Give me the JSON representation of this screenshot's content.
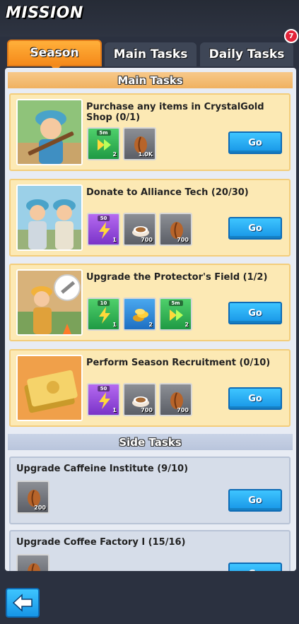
{
  "header": {
    "title": "MISSION"
  },
  "tabs": [
    {
      "label": "Season",
      "active": true
    },
    {
      "label": "Main Tasks",
      "active": false
    },
    {
      "label": "Daily Tasks",
      "active": false
    }
  ],
  "badge": {
    "count": "7"
  },
  "sections": {
    "main_title": "Main Tasks",
    "side_title": "Side Tasks"
  },
  "main_tasks": [
    {
      "title": "Purchase any items in CrystalGold Shop (0/1)",
      "thumb_icon": "soldier-with-rifle-icon",
      "rewards": [
        {
          "icon": "speedup-icon",
          "color": "green",
          "tag": "5m",
          "qty": "2"
        },
        {
          "icon": "coffee-bean-icon",
          "color": "gray",
          "tag": "",
          "qty": "1.0K"
        }
      ],
      "go_label": "Go"
    },
    {
      "title": "Donate to Alliance Tech (20/30)",
      "thumb_icon": "two-soldiers-icon",
      "rewards": [
        {
          "icon": "lightning-icon",
          "color": "purple",
          "tag": "50",
          "qty": "1"
        },
        {
          "icon": "coffee-cup-icon",
          "color": "gray",
          "tag": "",
          "qty": "700"
        },
        {
          "icon": "coffee-bean-icon",
          "color": "gray",
          "tag": "",
          "qty": "700"
        }
      ],
      "go_label": "Go"
    },
    {
      "title": "Upgrade the Protector's Field (1/2)",
      "thumb_icon": "builder-hammer-icon",
      "rewards": [
        {
          "icon": "lightning-icon",
          "color": "green",
          "tag": "10",
          "qty": "1"
        },
        {
          "icon": "gold-coins-icon",
          "color": "blue",
          "tag": "",
          "qty": "2"
        },
        {
          "icon": "speedup-icon",
          "color": "green",
          "tag": "5m",
          "qty": "2"
        }
      ],
      "go_label": "Go"
    },
    {
      "title": "Perform Season Recruitment (0/10)",
      "thumb_icon": "gold-ticket-icon",
      "rewards": [
        {
          "icon": "lightning-icon",
          "color": "purple",
          "tag": "50",
          "qty": "1"
        },
        {
          "icon": "coffee-cup-icon",
          "color": "gray",
          "tag": "",
          "qty": "700"
        },
        {
          "icon": "coffee-bean-icon",
          "color": "gray",
          "tag": "",
          "qty": "700"
        }
      ],
      "go_label": "Go"
    }
  ],
  "side_tasks": [
    {
      "title": "Upgrade Caffeine Institute (9/10)",
      "rewards": [
        {
          "icon": "coffee-bean-icon",
          "color": "gray",
          "tag": "",
          "qty": "200"
        }
      ],
      "go_label": "Go"
    },
    {
      "title": "Upgrade Coffee Factory I (15/16)",
      "rewards": [
        {
          "icon": "coffee-bean-icon",
          "color": "gray",
          "tag": "",
          "qty": ""
        }
      ],
      "go_label": "Go"
    }
  ],
  "back_button": {
    "icon": "back-arrow-icon"
  },
  "colors": {
    "accent": "#f5891a",
    "go_button": "#1795e6",
    "card_gold": "#fce9b4",
    "card_blue": "#d6dde9"
  }
}
